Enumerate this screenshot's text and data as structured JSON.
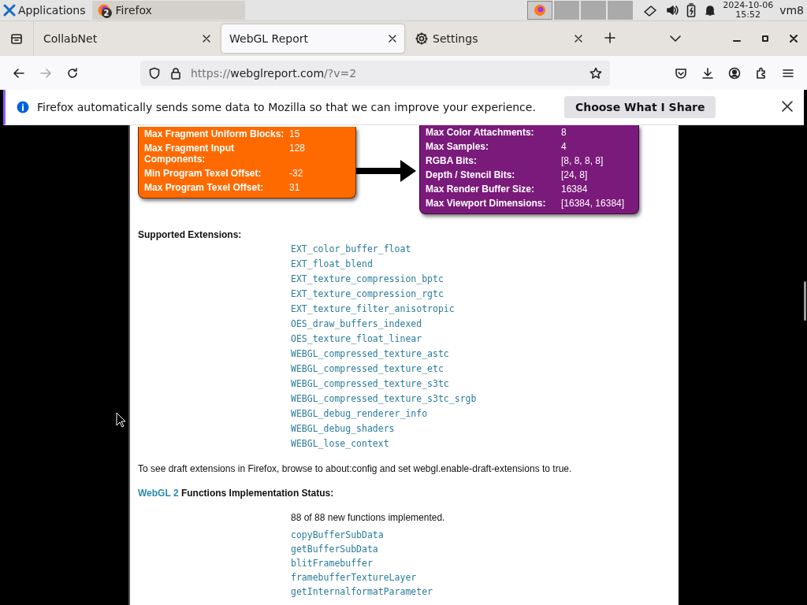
{
  "panel": {
    "apps_label": "Applications",
    "task_label": "Firefox",
    "task_count": "2",
    "date": "2024-10-06",
    "time": "15:52",
    "user": "vm8"
  },
  "tabs": [
    {
      "label": "CollabNet",
      "selected": false,
      "kind": "box"
    },
    {
      "label": "WebGL Report",
      "selected": true,
      "kind": "plain"
    },
    {
      "label": "Settings",
      "selected": false,
      "kind": "gear"
    }
  ],
  "address": {
    "scheme": "https://",
    "host": "webglreport.com",
    "path": "/?v=2"
  },
  "notice": {
    "text": "Firefox automatically sends some data to Mozilla so that we can improve your experience.",
    "button": "Choose What I Share"
  },
  "left_table": [
    {
      "label": "Max Fragment Uniform Blocks:",
      "value": "15"
    },
    {
      "label": "Max Fragment Input Components:",
      "value": "128"
    },
    {
      "label": "Min Program Texel Offset:",
      "value": "-32"
    },
    {
      "label": "Max Program Texel Offset:",
      "value": "31"
    }
  ],
  "right_table": [
    {
      "label": "Max Color Attachments:",
      "value": "8"
    },
    {
      "label": "Max Samples:",
      "value": "4"
    },
    {
      "label": "RGBA Bits:",
      "value": "[8, 8, 8, 8]"
    },
    {
      "label": "Depth / Stencil Bits:",
      "value": "[24, 8]"
    },
    {
      "label": "Max Render Buffer Size:",
      "value": "16384"
    },
    {
      "label": "Max Viewport Dimensions:",
      "value": "[16384, 16384]"
    }
  ],
  "extensions": {
    "heading": "Supported Extensions:",
    "items": [
      "EXT_color_buffer_float",
      "EXT_float_blend",
      "EXT_texture_compression_bptc",
      "EXT_texture_compression_rgtc",
      "EXT_texture_filter_anisotropic",
      "OES_draw_buffers_indexed",
      "OES_texture_float_linear",
      "WEBGL_compressed_texture_astc",
      "WEBGL_compressed_texture_etc",
      "WEBGL_compressed_texture_s3tc",
      "WEBGL_compressed_texture_s3tc_srgb",
      "WEBGL_debug_renderer_info",
      "WEBGL_debug_shaders",
      "WEBGL_lose_context"
    ]
  },
  "draft_note": "To see draft extensions in Firefox, browse to about:config and set webgl.enable-draft-extensions to true.",
  "functions": {
    "link": "WebGL 2",
    "heading": "Functions Implementation Status:",
    "summary": "88 of 88 new functions implemented.",
    "items": [
      "copyBufferSubData",
      "getBufferSubData",
      "blitFramebuffer",
      "framebufferTextureLayer",
      "getInternalformatParameter"
    ]
  }
}
